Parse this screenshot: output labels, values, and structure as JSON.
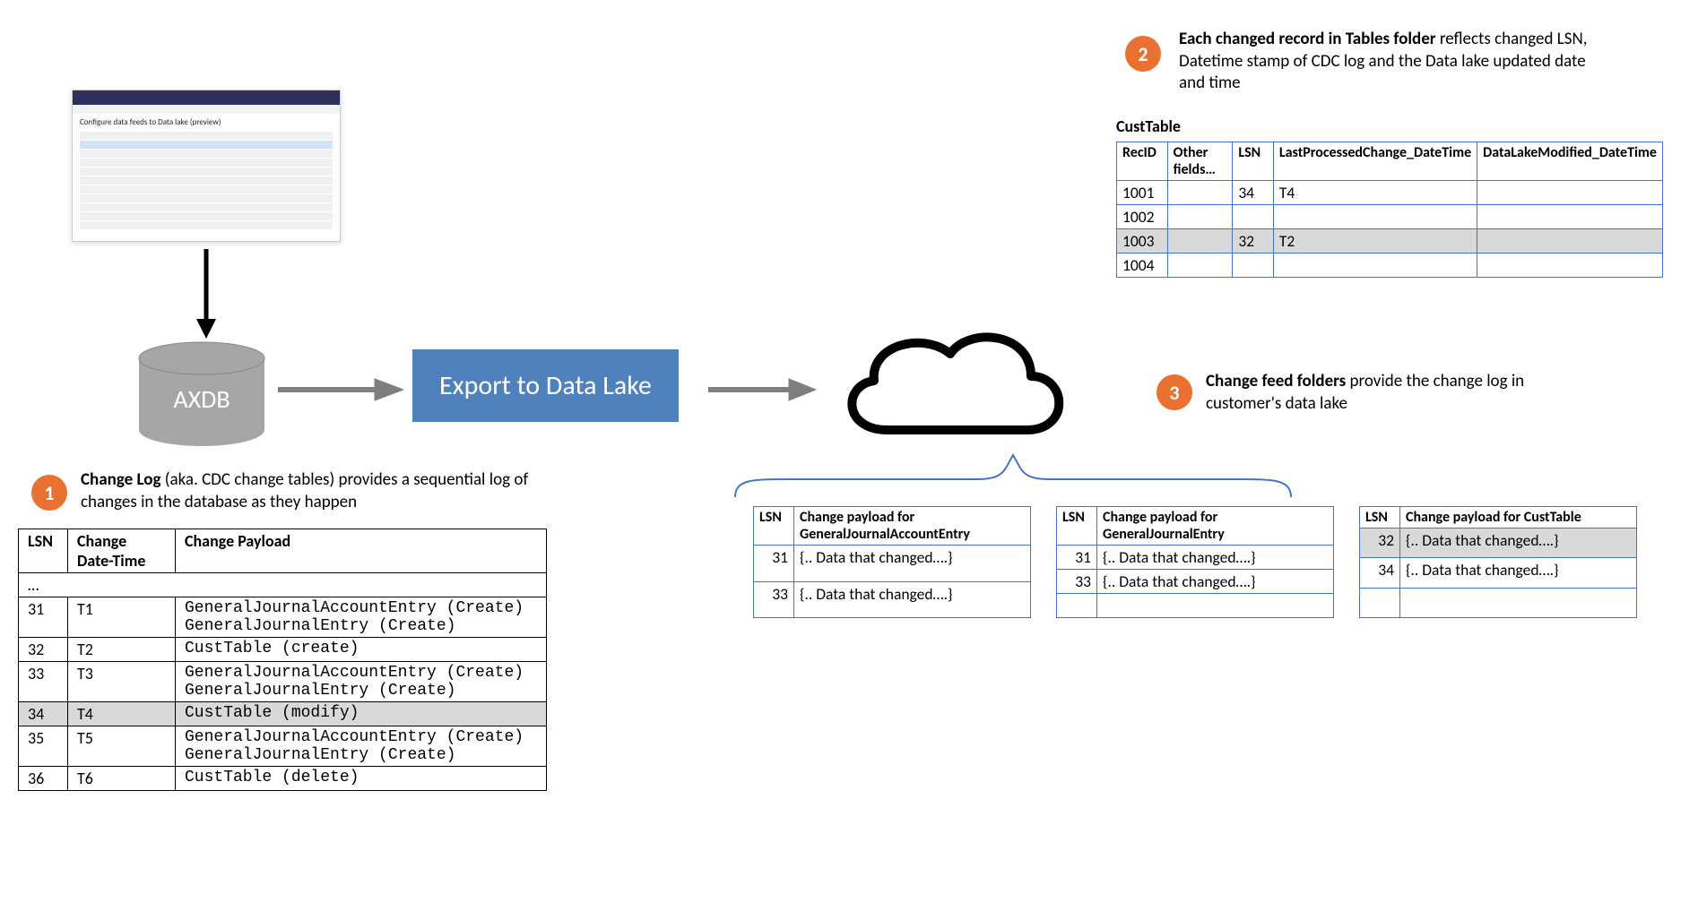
{
  "flow": {
    "export_label": "Export to Data Lake",
    "db_label": "AXDB",
    "mini_title": "Configure data feeds to Data lake (preview)"
  },
  "annot1": {
    "num": "1",
    "bold": "Change Log",
    "rest": " (aka. CDC change tables) provides a sequential log of changes in the database as they happen"
  },
  "annot2": {
    "num": "2",
    "bold": "Each changed record in Tables folder",
    "rest": " reflects changed LSN, Datetime stamp of CDC log and the Data lake updated date and time"
  },
  "annot3": {
    "num": "3",
    "bold": "Change feed folders",
    "rest": " provide the change log in customer's data lake"
  },
  "changelog": {
    "headers": {
      "lsn": "LSN",
      "dt": "Change Date-Time",
      "payload": "Change Payload"
    },
    "ellipsis": "…",
    "rows": [
      {
        "lsn": "31",
        "dt": "T1",
        "payload": "GeneralJournalAccountEntry (Create)\nGeneralJournalEntry (Create)",
        "hl": false
      },
      {
        "lsn": "32",
        "dt": "T2",
        "payload": "CustTable (create)",
        "hl": false
      },
      {
        "lsn": "33",
        "dt": "T3",
        "payload": "GeneralJournalAccountEntry (Create)\nGeneralJournalEntry (Create)",
        "hl": false
      },
      {
        "lsn": "34",
        "dt": "T4",
        "payload": "CustTable (modify)",
        "hl": true
      },
      {
        "lsn": "35",
        "dt": "T5",
        "payload": "GeneralJournalAccountEntry (Create)\nGeneralJournalEntry (Create)",
        "hl": false
      },
      {
        "lsn": "36",
        "dt": "T6",
        "payload": "CustTable (delete)",
        "hl": false
      }
    ]
  },
  "custtable": {
    "title": "CustTable",
    "headers": {
      "recid": "RecID",
      "other": "Other fields…",
      "lsn": "LSN",
      "lp": "LastProcessedChange_DateTime",
      "dl": "DataLakeModified_DateTime"
    },
    "rows": [
      {
        "recid": "1001",
        "other": "",
        "lsn": "34",
        "lp": "T4",
        "dl": "",
        "hl": false
      },
      {
        "recid": "1002",
        "other": "",
        "lsn": "",
        "lp": "",
        "dl": "",
        "hl": false
      },
      {
        "recid": "1003",
        "other": "",
        "lsn": "32",
        "lp": "T2",
        "dl": "",
        "hl": true
      },
      {
        "recid": "1004",
        "other": "",
        "lsn": "",
        "lp": "",
        "dl": "",
        "hl": false
      }
    ]
  },
  "feeds": {
    "lsn_header": "LSN",
    "payload_prefix": "Change payload for ",
    "sample": "{.. Data that changed….}",
    "tables": [
      {
        "name": "GeneralJournalAccountEntry",
        "rows": [
          {
            "lsn": "31",
            "hl": false
          },
          {
            "lsn": "33",
            "hl": false
          }
        ],
        "blanks": 0
      },
      {
        "name": "GeneralJournalEntry",
        "rows": [
          {
            "lsn": "31",
            "hl": false
          },
          {
            "lsn": "33",
            "hl": false
          }
        ],
        "blanks": 1
      },
      {
        "name": "CustTable",
        "rows": [
          {
            "lsn": "32",
            "hl": true
          },
          {
            "lsn": "34",
            "hl": false
          }
        ],
        "blanks": 1
      }
    ]
  }
}
